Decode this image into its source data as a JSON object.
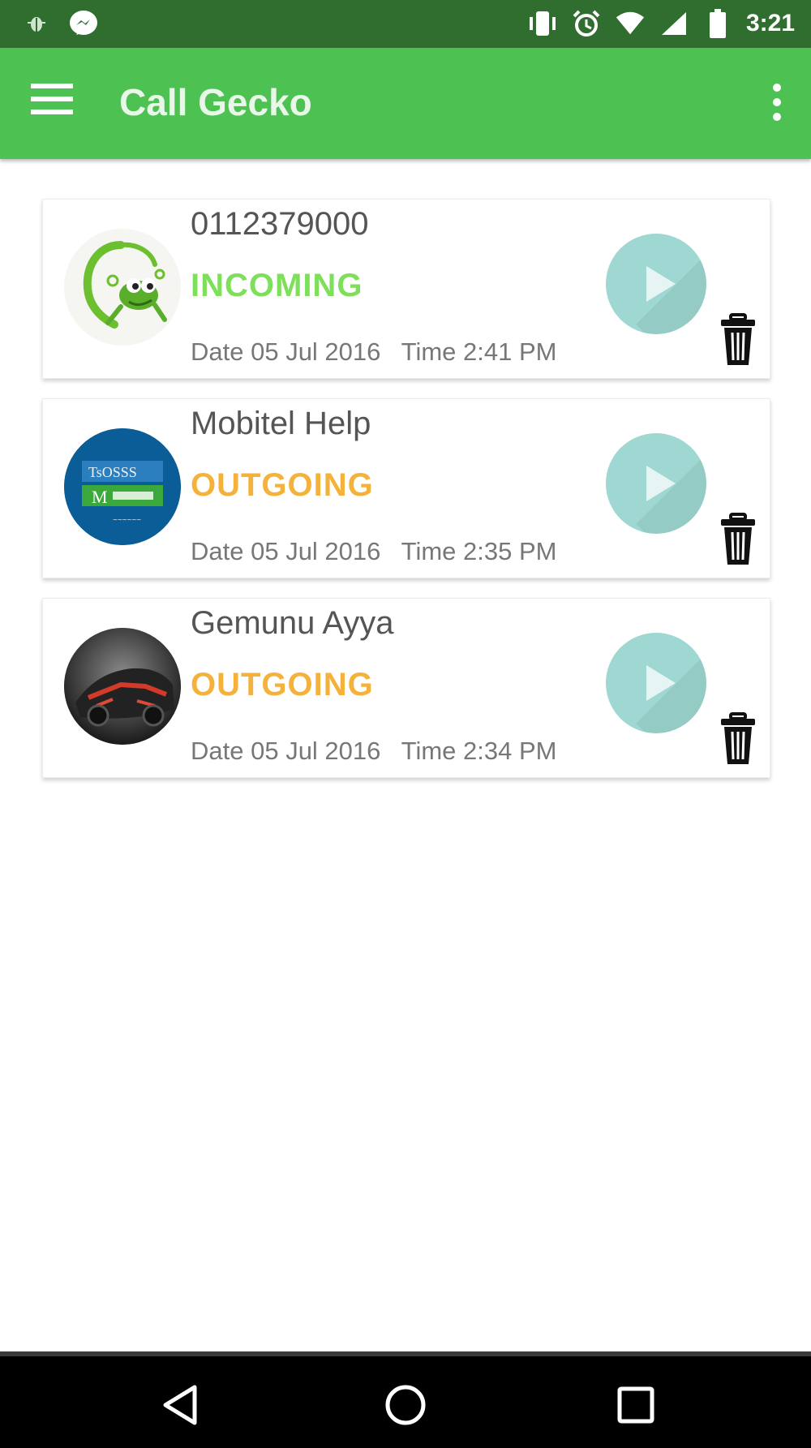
{
  "status_bar": {
    "time": "3:21",
    "icons": [
      "bug-icon",
      "messenger-icon",
      "vibrate-icon",
      "alarm-icon",
      "wifi-icon",
      "cell-signal-icon",
      "battery-icon"
    ]
  },
  "app_bar": {
    "title": "Call Gecko",
    "menu_icon": "hamburger-menu-icon",
    "overflow_icon": "more-vert-icon"
  },
  "recordings": [
    {
      "name": "0112379000",
      "call_type": "INCOMING",
      "date_time": "Date 05 Jul 2016   Time 2:41 PM",
      "avatar": "gecko-logo",
      "type_color": "#7ee05a"
    },
    {
      "name": "Mobitel Help",
      "call_type": "OUTGOING",
      "date_time": "Date 05 Jul 2016   Time 2:35 PM",
      "avatar": "mobitel-logo",
      "type_color": "#f5b23a"
    },
    {
      "name": "Gemunu Ayya",
      "call_type": "OUTGOING",
      "date_time": "Date 05 Jul 2016   Time 2:34 PM",
      "avatar": "car-photo",
      "type_color": "#f5b23a"
    }
  ],
  "colors": {
    "status_bar": "#2f6e2f",
    "app_bar": "#4dc152",
    "play_button": "#9fd8d2",
    "incoming": "#7ee05a",
    "outgoing": "#f5b23a"
  },
  "nav_bar": {
    "icons": [
      "back-icon",
      "home-icon",
      "recents-icon"
    ]
  }
}
